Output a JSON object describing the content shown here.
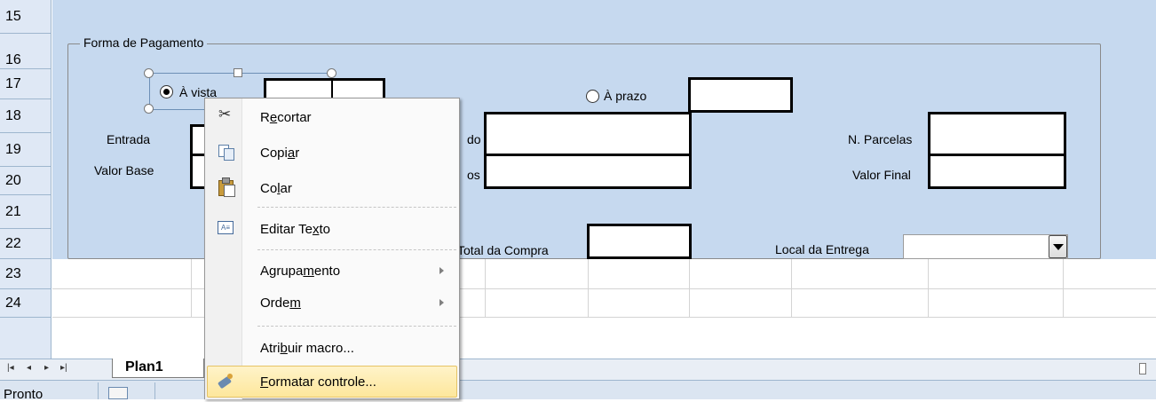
{
  "rows": [
    "15",
    "16",
    "17",
    "18",
    "19",
    "20",
    "21",
    "22",
    "23",
    "24"
  ],
  "form": {
    "group_title": "Forma de Pagamento",
    "radio_avista": "À vista",
    "radio_aprazo": "À prazo",
    "label_entrada": "Entrada",
    "label_valor_base": "Valor Base",
    "label_partial_do": "do",
    "label_partial_os": "os",
    "label_total_compra": "Total da Compra",
    "label_n_parcelas": "N. Parcelas",
    "label_valor_final": "Valor Final",
    "label_local_entrega": "Local da Entrega"
  },
  "menu": {
    "recortar": {
      "pre": "R",
      "u": "e",
      "post": "cortar"
    },
    "copiar": {
      "pre": "Copi",
      "u": "a",
      "post": "r"
    },
    "colar": {
      "pre": "Co",
      "u": "l",
      "post": "ar"
    },
    "editar_texto": {
      "pre": "Editar Te",
      "u": "x",
      "post": "to"
    },
    "agrupamento": {
      "pre": "Agrupa",
      "u": "m",
      "post": "ento"
    },
    "ordem": {
      "pre": "Orde",
      "u": "m",
      "post": ""
    },
    "atribuir_macro": {
      "pre": "Atri",
      "u": "b",
      "post": "uir macro..."
    },
    "formatar_controle": {
      "pre": "",
      "u": "F",
      "post": "ormatar controle..."
    }
  },
  "sheet_tab": "Plan1",
  "status": "Pronto",
  "icons": {
    "cut": "scissors-icon",
    "copy": "copy-icon",
    "paste": "paste-icon",
    "edit_text": "text-box-icon",
    "format": "format-control-icon"
  },
  "colors": {
    "panel": "#c6d9ef",
    "row_header": "#dfe8f5",
    "menu_highlight": "#fde79c"
  }
}
